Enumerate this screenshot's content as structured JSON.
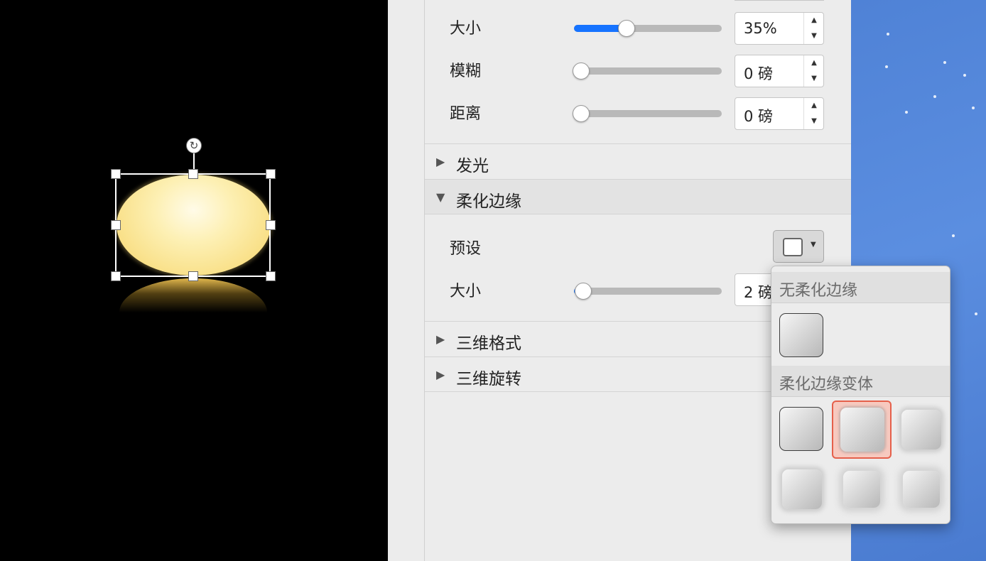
{
  "inspector": {
    "shadow_rows": [
      {
        "label": "大小",
        "value": "35%",
        "slider_fraction": 0.35
      },
      {
        "label": "模糊",
        "value": "0 磅",
        "slider_fraction": 0.0
      },
      {
        "label": "距离",
        "value": "0 磅",
        "slider_fraction": 0.0
      }
    ],
    "sections": {
      "glow": "发光",
      "soft_edges": "柔化边缘",
      "format_3d": "三维格式",
      "rotation_3d": "三维旋转"
    },
    "soft_edges": {
      "preset_label": "预设",
      "size_label": "大小",
      "size_value": "2 磅",
      "size_slider_fraction": 0.05
    }
  },
  "popup": {
    "header_none": "无柔化边缘",
    "header_variations": "柔化边缘变体",
    "selected_variation_index": 1
  },
  "icons": {
    "rotate": "rotate-icon",
    "collapsed": "disclosure-right-icon",
    "expanded": "disclosure-down-icon"
  },
  "colors": {
    "slider_accent": "#1673ff",
    "selection_highlight": "#e5604b",
    "ellipse_fill": "#f6d56a",
    "desktop_blue": "#5b8ee0"
  }
}
